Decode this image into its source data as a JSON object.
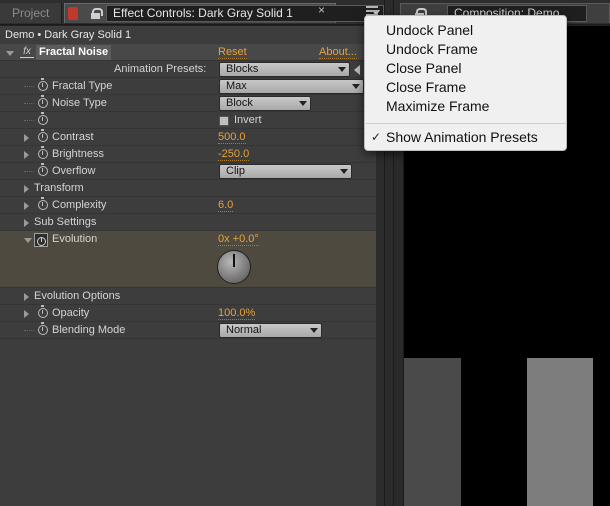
{
  "tabs": {
    "project_label": "Project",
    "effect_controls_label": "Effect Controls: Dark Gray Solid 1",
    "composition_label": "Composition: Demo",
    "close_glyph": "×"
  },
  "breadcrumb": "Demo • Dark Gray Solid 1",
  "effect": {
    "fx_badge": "fx",
    "name": "Fractal Noise",
    "reset_label": "Reset",
    "about_label": "About...",
    "presets_label": "Animation Presets:",
    "presets_value": "Blocks"
  },
  "params": {
    "fractal_type": {
      "label": "Fractal Type",
      "value": "Max"
    },
    "noise_type": {
      "label": "Noise Type",
      "value": "Block"
    },
    "invert": {
      "label": "Invert"
    },
    "contrast": {
      "label": "Contrast",
      "value": "500.0"
    },
    "brightness": {
      "label": "Brightness",
      "value": "-250.0"
    },
    "overflow": {
      "label": "Overflow",
      "value": "Clip"
    },
    "transform": {
      "label": "Transform"
    },
    "complexity": {
      "label": "Complexity",
      "value": "6.0"
    },
    "sub_settings": {
      "label": "Sub Settings"
    },
    "evolution": {
      "label": "Evolution",
      "value": "0x +0.0°"
    },
    "evolution_options": {
      "label": "Evolution Options"
    },
    "opacity": {
      "label": "Opacity",
      "value": "100.0%"
    },
    "blending_mode": {
      "label": "Blending Mode",
      "value": "Normal"
    }
  },
  "context_menu": {
    "items": [
      {
        "label": "Undock Panel"
      },
      {
        "label": "Undock Frame"
      },
      {
        "label": "Close Panel"
      },
      {
        "label": "Close Frame"
      },
      {
        "label": "Maximize Frame"
      }
    ],
    "show_presets": {
      "label": "Show Animation Presets",
      "check": "✓"
    }
  },
  "colors": {
    "value_orange": "#e8a23a",
    "panel_bg": "#3d3d3d",
    "evolution_highlight": "#4f4a3f",
    "menu_bg": "#f0f0f0"
  }
}
